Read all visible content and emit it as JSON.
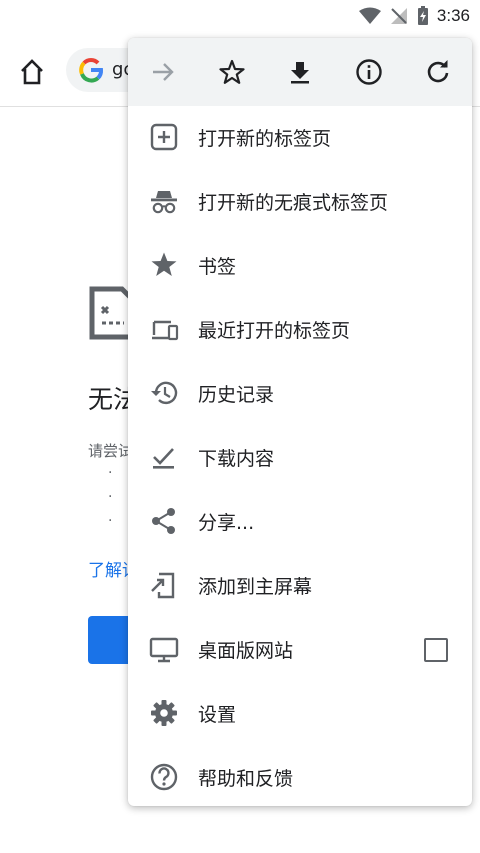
{
  "status_bar": {
    "time": "3:36"
  },
  "toolbar": {
    "url_text": "gc"
  },
  "page": {
    "error_title": "无法",
    "error_sub": "请尝试",
    "bullets": [
      "·",
      "·",
      "·"
    ],
    "learn_more": "了解详"
  },
  "menu": {
    "actions": [
      "forward-icon",
      "star-icon",
      "download-icon",
      "info-icon",
      "refresh-icon"
    ],
    "items": [
      {
        "label": "打开新的标签页",
        "icon": "new-tab-icon"
      },
      {
        "label": "打开新的无痕式标签页",
        "icon": "incognito-icon"
      },
      {
        "label": "书签",
        "icon": "bookmark-star-icon"
      },
      {
        "label": "最近打开的标签页",
        "icon": "recent-tabs-icon"
      },
      {
        "label": "历史记录",
        "icon": "history-icon"
      },
      {
        "label": "下载内容",
        "icon": "downloads-icon"
      },
      {
        "label": "分享...",
        "icon": "share-icon"
      },
      {
        "label": "添加到主屏幕",
        "icon": "add-to-home-icon"
      },
      {
        "label": "桌面版网站",
        "icon": "desktop-icon",
        "checkbox": false
      },
      {
        "label": "设置",
        "icon": "settings-gear-icon"
      },
      {
        "label": "帮助和反馈",
        "icon": "help-icon"
      }
    ]
  },
  "colors": {
    "accent": "#1a73e8",
    "icon": "#5f6368",
    "menu_header": "#f1f3f4"
  }
}
